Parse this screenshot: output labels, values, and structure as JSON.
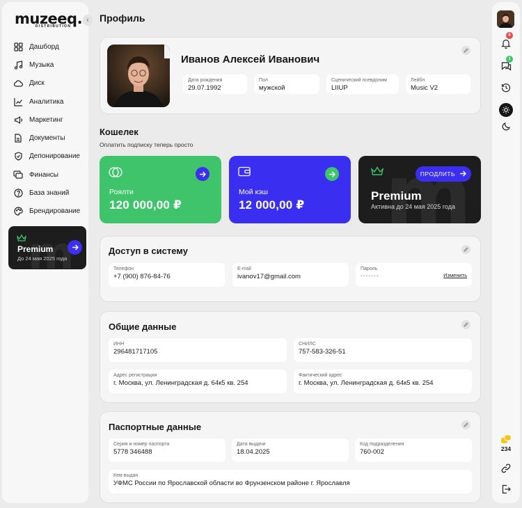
{
  "app": {
    "logo": "muzeeq.",
    "logo_sub": "DISTRIBUTION",
    "collapse_icon": "chevron-left-icon"
  },
  "sidebar": {
    "items": [
      {
        "label": "Дашборд",
        "icon": "grid-icon"
      },
      {
        "label": "Музыка",
        "icon": "music-note-icon"
      },
      {
        "label": "Диск",
        "icon": "cloud-icon"
      },
      {
        "label": "Аналитика",
        "icon": "chart-icon"
      },
      {
        "label": "Маркетинг",
        "icon": "megaphone-icon"
      },
      {
        "label": "Документы",
        "icon": "document-icon"
      },
      {
        "label": "Депонирование",
        "icon": "shield-check-icon"
      },
      {
        "label": "Финансы",
        "icon": "cards-icon"
      },
      {
        "label": "База знаний",
        "icon": "question-circle-icon"
      },
      {
        "label": "Брендирование",
        "icon": "palette-icon"
      }
    ],
    "promo": {
      "title": "Premium",
      "subtitle": "До 24 мая 2025 года"
    }
  },
  "page": {
    "title": "Профиль"
  },
  "profile": {
    "name": "Иванов Алексей Иванович",
    "fields": [
      {
        "label": "Дата рождения",
        "value": "29.07.1992"
      },
      {
        "label": "Пол",
        "value": "мужской"
      },
      {
        "label": "Сценический псевдоним",
        "value": "LIIUP"
      },
      {
        "label": "Лейбл",
        "value": "Music V2"
      }
    ]
  },
  "wallet": {
    "title": "Кошелек",
    "subtitle": "Оплатить подписку теперь просто",
    "royalty": {
      "label": "Роялти",
      "amount": "120 000,00 ₽",
      "color": "#3fc46b"
    },
    "cash": {
      "label": "Мой кэш",
      "amount": "12 000,00 ₽",
      "color": "#3a2ef0"
    },
    "premium": {
      "title": "Premium",
      "subtitle": "Активна до 24 мая 2025 года",
      "button": "ПРОДЛИТЬ"
    }
  },
  "access": {
    "title": "Доступ в систему",
    "phone": {
      "label": "Телефон",
      "value": "+7 (900) 876-84-76"
    },
    "email": {
      "label": "E-mail",
      "value": "ivanov17@gmail.com"
    },
    "password": {
      "label": "Пароль",
      "value": "•••••••",
      "change": "Изменить"
    }
  },
  "general": {
    "title": "Общие данные",
    "inn": {
      "label": "ИНН",
      "value": "296481717105"
    },
    "snils": {
      "label": "СНИЛС",
      "value": "757-583-326-51"
    },
    "reg_address": {
      "label": "Адрес регистрации",
      "value": "г. Москва, ул. Ленинградская д. 64к5 кв. 254"
    },
    "actual_address": {
      "label": "Фактический адрес",
      "value": "г. Москва, ул. Ленинградская д. 64к5 кв. 254"
    }
  },
  "passport": {
    "title": "Паспортные данные",
    "number": {
      "label": "Серия и номер паспорта",
      "value": "5778 346488"
    },
    "issue_date": {
      "label": "Дата выдачи",
      "value": "18.04.2025"
    },
    "dept_code": {
      "label": "Код подразделения",
      "value": "760-002"
    },
    "issued_by": {
      "label": "Кем выдан",
      "value": "УФМС России по Ярославской области во Фрунзенском районе г.  Ярославля"
    }
  },
  "rightbar": {
    "notifications_count": "6",
    "messages_count": "1",
    "coins": "234"
  },
  "colors": {
    "accent": "#3a2ef0",
    "green": "#3fc46b",
    "badge_red": "#e5484d",
    "badge_green": "#3fc46b",
    "coin": "#f5c518"
  }
}
